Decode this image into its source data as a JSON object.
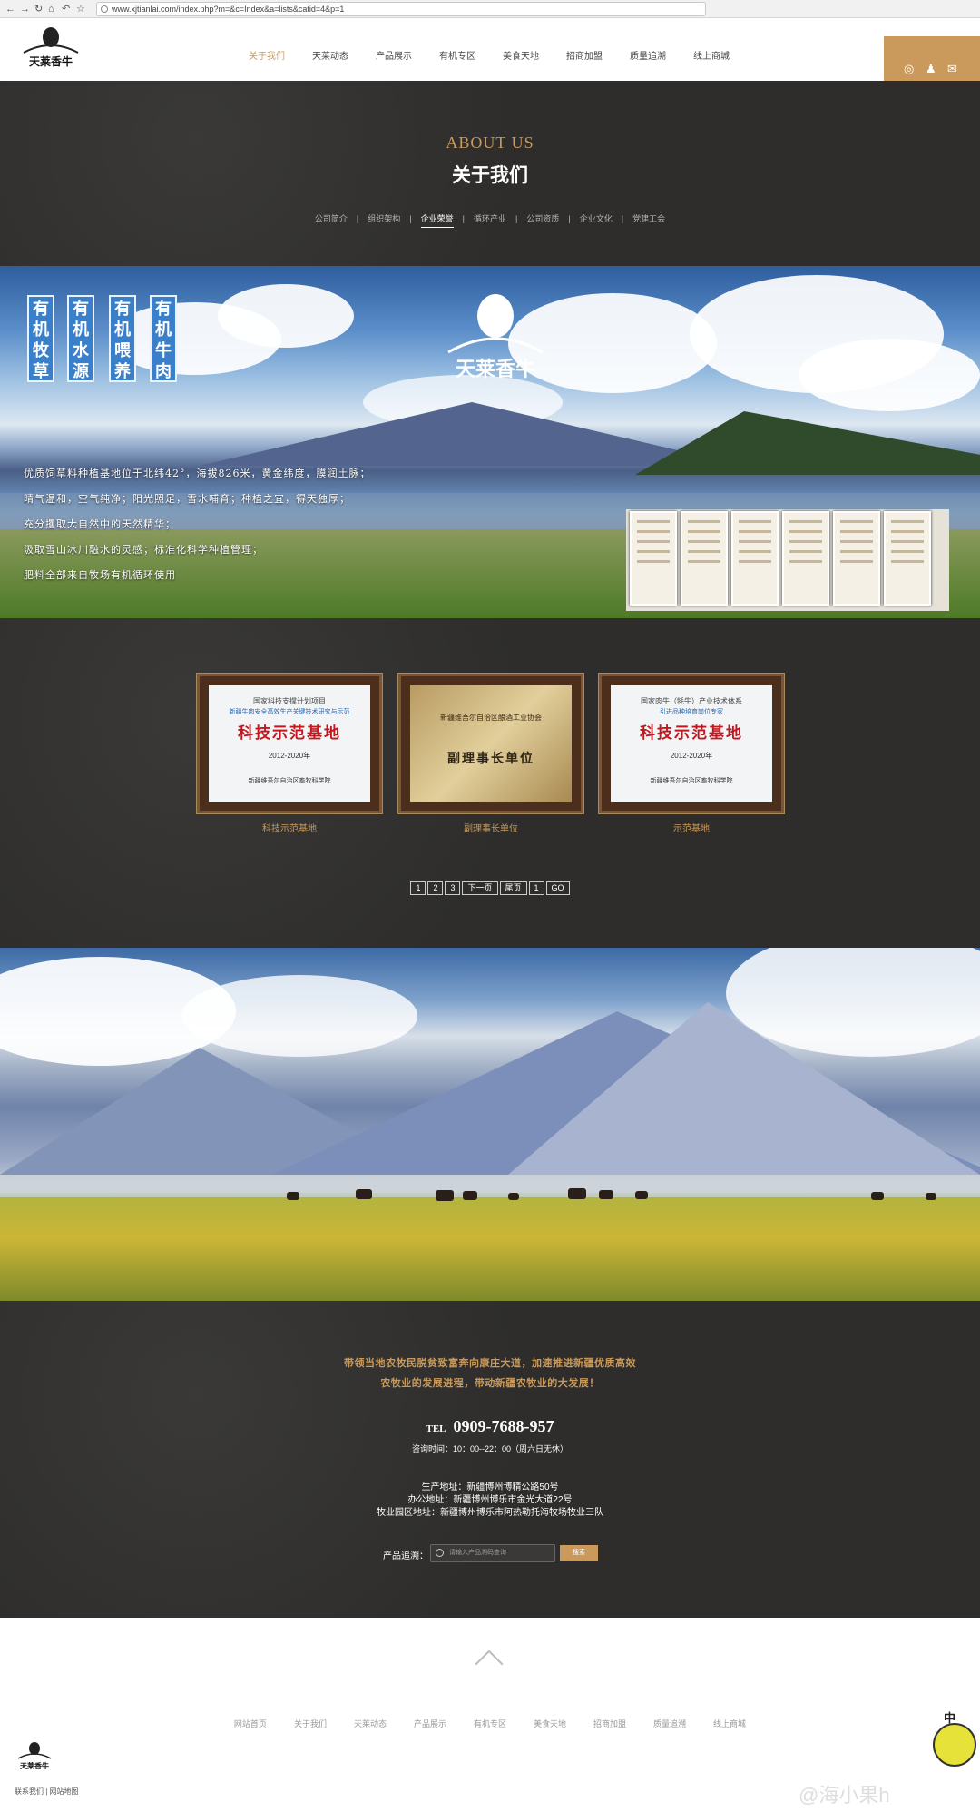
{
  "browser": {
    "url": "www.xjtianlai.com/index.php?m=&c=Index&a=lists&catid=4&p=1",
    "nav_icons": [
      "back-icon",
      "forward-icon",
      "reload-icon",
      "home-icon",
      "undo-icon",
      "star-icon"
    ]
  },
  "header": {
    "logo_text": "天莱香牛",
    "menu": [
      {
        "label": "关于我们",
        "active": true
      },
      {
        "label": "天莱动态",
        "active": false
      },
      {
        "label": "产品展示",
        "active": false
      },
      {
        "label": "有机专区",
        "active": false
      },
      {
        "label": "美食天地",
        "active": false
      },
      {
        "label": "招商加盟",
        "active": false
      },
      {
        "label": "质量追溯",
        "active": false
      },
      {
        "label": "线上商城",
        "active": false
      }
    ],
    "social_icons": [
      "weibo-icon",
      "qq-icon",
      "wechat-icon"
    ],
    "accent_color": "#c99a5b"
  },
  "about": {
    "title_en": "ABOUT US",
    "title_cn": "关于我们",
    "subnav": [
      "公司简介",
      "组织架构",
      "企业荣誉",
      "循环产业",
      "公司资质",
      "企业文化",
      "党建工会"
    ],
    "current": "企业荣誉"
  },
  "banner1": {
    "tags": [
      "有机牧草",
      "有机水源",
      "有机喂养",
      "有机牛肉"
    ],
    "brand": "天莱香牛",
    "lines": [
      "优质饲草料种植基地位于北纬42°，海拔826米，黄金纬度，膜润土脉；",
      "晴气温和，空气纯净；阳光照足，雪水哺育；种植之宜，得天独厚；",
      "充分攫取大自然中的天然精华；",
      "汲取雪山冰川融水的灵感；标准化科学种植管理；",
      "肥料全部来自牧场有机循环使用"
    ]
  },
  "awards": {
    "items": [
      {
        "caption": "科技示范基地",
        "plaque": {
          "line1": "国家科技支撑计划项目",
          "line1b": "新疆牛肉安全高效生产关键技术研究与示范",
          "main": "科技示范基地",
          "years": "2012-2020年",
          "issuer": "新疆维吾尔自治区畜牧科学院"
        }
      },
      {
        "caption": "副理事长单位",
        "plaque": {
          "line1": "新疆维吾尔自治区酿酒工业协会",
          "line1b": "",
          "main": "副理事长单位",
          "years": "",
          "issuer": ""
        }
      },
      {
        "caption": "示范基地",
        "plaque": {
          "line1": "国家肉牛（牦牛）产业技术体系",
          "line1b": "引进品种培育岗位专家",
          "main": "科技示范基地",
          "years": "2012-2020年",
          "issuer": "新疆维吾尔自治区畜牧科学院"
        }
      }
    ],
    "pager": [
      "1",
      "2",
      "3",
      "下一页",
      "尾页",
      "1",
      "GO"
    ]
  },
  "footer": {
    "slogan1": "带领当地农牧民脱贫致富奔向康庄大道，加速推进新疆优质高效",
    "slogan2": "农牧业的发展进程，带动新疆农牧业的大发展！",
    "tel_label": "TEL",
    "tel": "0909-7688-957",
    "hours": "咨询时间：10：00--22：00（周六日无休）",
    "addr1": "生产地址：新疆博州博精公路50号",
    "addr2": "办公地址：新疆博州博乐市金光大道22号",
    "addr3": "牧业园区地址：新疆博州博乐市阿热勒托海牧场牧业三队",
    "search_label": "产品追溯：",
    "search_placeholder": "请输入产品溯码查询",
    "search_button": "搜索"
  },
  "bottom": {
    "nav": [
      "网站首页",
      "关于我们",
      "天莱动态",
      "产品展示",
      "有机专区",
      "美食天地",
      "招商加盟",
      "质量追溯",
      "线上商城"
    ],
    "links": "联系我们 | 网站地图",
    "mascot_text": "中",
    "watermark": "@海小果h"
  }
}
